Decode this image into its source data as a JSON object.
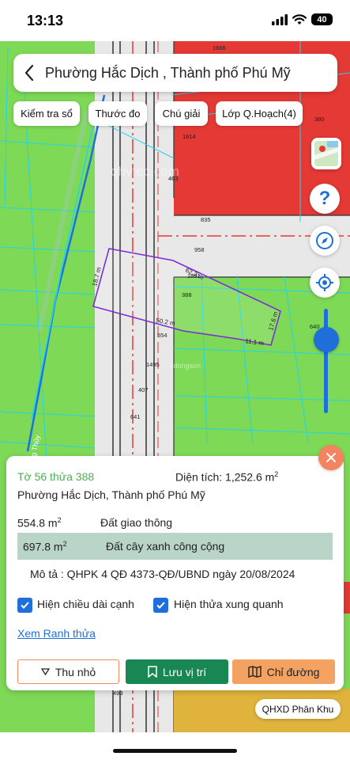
{
  "status_bar": {
    "time": "13:13",
    "battery": "40"
  },
  "header": {
    "title": "Phường Hắc Dịch , Thành phố Phú Mỹ"
  },
  "chips": [
    {
      "label": "Kiểm tra sổ"
    },
    {
      "label": "Thước đo"
    },
    {
      "label": "Chú giải"
    },
    {
      "label": "Lớp Q.Hoạch(4)"
    }
  ],
  "map": {
    "watermark": "qhvtec.com",
    "watermark2": "Tdongson",
    "road_label": "Đường Thủy",
    "parcel_labels": [
      "1666",
      "380",
      "1814",
      "463",
      "835",
      "958",
      "1891",
      "388",
      "554",
      "1495",
      "407",
      "641",
      "640",
      "493"
    ],
    "dimensions": {
      "top": "62.3 m",
      "left": "18.7 m",
      "bottom": "50.2 m",
      "right": "17.6 m",
      "bottom_right": "11.1 m"
    },
    "colors": {
      "green": "#7ed957",
      "red": "#e53935",
      "road": "#e8e8e8",
      "parcel_outline": "#7b2fd0"
    }
  },
  "info": {
    "parcel": "Tờ 56 thửa 388",
    "area_label": "Diện tích: 1,252.6 m",
    "area_sup": "2",
    "ward": "Phường Hắc Dịch, Thành phố Phú Mỹ",
    "uses": [
      {
        "area": "554.8 m",
        "sup": "2",
        "name": "Đất giao thông"
      },
      {
        "area": "697.8 m",
        "sup": "2",
        "name": "Đất cây xanh công cộng"
      }
    ],
    "description": "Mô tả : QHPK 4 QĐ 4373-QĐ/UBND ngày 20/08/2024",
    "check_edge_length": "Hiện chiều dài cạnh",
    "check_neighbors": "Hiện thửa xung quanh",
    "view_boundary": "Xem Ranh thửa",
    "btn_collapse": "Thu nhỏ",
    "btn_save": "Lưu vị trí",
    "btn_route": "Chỉ đường"
  },
  "mode_chip": "QHXD Phân Khu"
}
